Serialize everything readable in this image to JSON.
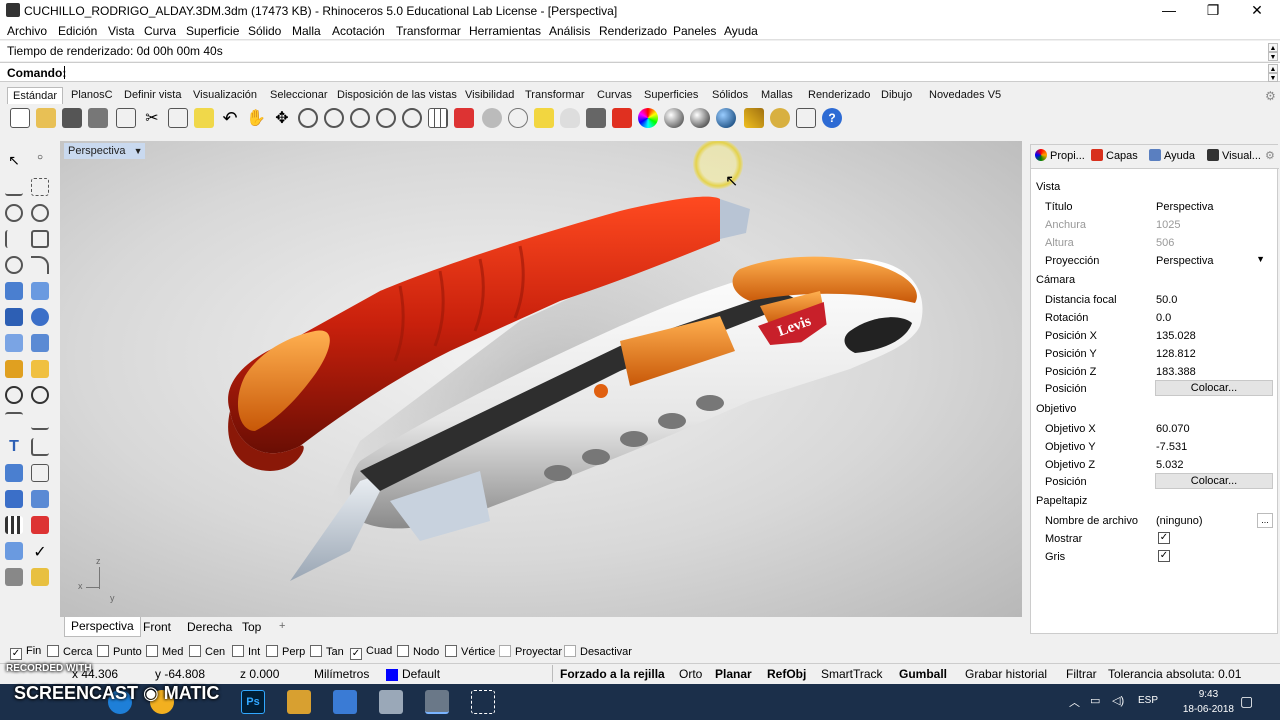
{
  "window": {
    "title": "CUCHILLO_RODRIGO_ALDAY.3DM.3dm (17473 KB) - Rhinoceros 5.0 Educational Lab License - [Perspectiva]",
    "minimize": "—",
    "maximize": "❐",
    "close": "✕"
  },
  "menu": [
    "Archivo",
    "Edición",
    "Vista",
    "Curva",
    "Superficie",
    "Sólido",
    "Malla",
    "Acotación",
    "Transformar",
    "Herramientas",
    "Análisis",
    "Renderizado",
    "Paneles",
    "Ayuda"
  ],
  "history": "Tiempo de renderizado: 0d 00h 00m 40s",
  "command": {
    "label": "Comando:",
    "value": ""
  },
  "toolbar_tabs": [
    "Estándar",
    "PlanosC",
    "Definir vista",
    "Visualización",
    "Seleccionar",
    "Disposición de las vistas",
    "Visibilidad",
    "Transformar",
    "Curvas",
    "Superficies",
    "Sólidos",
    "Mallas",
    "Renderizado",
    "Dibujo",
    "Novedades V5"
  ],
  "viewport": {
    "title": "Perspectiva",
    "axes_z": "z",
    "axes_x": "x",
    "axes_y": "y",
    "logo_text": "Levis"
  },
  "viewport_tabs": [
    "Perspectiva",
    "Front",
    "Derecha",
    "Top",
    "+"
  ],
  "panel": {
    "tabs": [
      "Propi...",
      "Capas",
      "Ayuda",
      "Visual..."
    ],
    "sections": {
      "vista": "Vista",
      "camara": "Cámara",
      "objetivo": "Objetivo",
      "papeltapiz": "Papeltapiz"
    },
    "rows": {
      "titulo": {
        "k": "Título",
        "v": "Perspectiva"
      },
      "anchura": {
        "k": "Anchura",
        "v": "1025"
      },
      "altura": {
        "k": "Altura",
        "v": "506"
      },
      "proyeccion": {
        "k": "Proyección",
        "v": "Perspectiva"
      },
      "focal": {
        "k": "Distancia focal",
        "v": "50.0"
      },
      "rotacion": {
        "k": "Rotación",
        "v": "0.0"
      },
      "posx": {
        "k": "Posición X",
        "v": "135.028"
      },
      "posy": {
        "k": "Posición Y",
        "v": "128.812"
      },
      "posz": {
        "k": "Posición Z",
        "v": "183.388"
      },
      "pos": {
        "k": "Posición",
        "v": "Colocar..."
      },
      "objx": {
        "k": "Objetivo X",
        "v": "60.070"
      },
      "objy": {
        "k": "Objetivo Y",
        "v": "-7.531"
      },
      "objz": {
        "k": "Objetivo Z",
        "v": "5.032"
      },
      "pos2": {
        "k": "Posición",
        "v": "Colocar..."
      },
      "archivo": {
        "k": "Nombre de archivo",
        "v": "(ninguno)",
        "btn": "..."
      },
      "mostrar": {
        "k": "Mostrar",
        "v": "✓"
      },
      "gris": {
        "k": "Gris",
        "v": "✓"
      }
    }
  },
  "osnaps": [
    {
      "label": "Fin",
      "checked": true
    },
    {
      "label": "Cerca",
      "checked": false
    },
    {
      "label": "Punto",
      "checked": false
    },
    {
      "label": "Med",
      "checked": false
    },
    {
      "label": "Cen",
      "checked": false
    },
    {
      "label": "Int",
      "checked": false
    },
    {
      "label": "Perp",
      "checked": false
    },
    {
      "label": "Tan",
      "checked": false
    },
    {
      "label": "Cuad",
      "checked": true
    },
    {
      "label": "Nodo",
      "checked": false
    },
    {
      "label": "Vértice",
      "checked": false
    },
    {
      "label": "Proyectar",
      "checked": false
    },
    {
      "label": "Desactivar",
      "checked": false
    }
  ],
  "status": {
    "x": "x 44.306",
    "y": "y -64.808",
    "z": "z 0.000",
    "units": "Milímetros",
    "layer": "Default",
    "grid": "Forzado a la rejilla",
    "orto": "Orto",
    "planar": "Planar",
    "refobj": "RefObj",
    "smarttrack": "SmartTrack",
    "gumball": "Gumball",
    "history": "Grabar historial",
    "filter": "Filtrar",
    "tolerance": "Tolerancia absoluta: 0.01"
  },
  "taskbar": {
    "lang": "ESP",
    "time": "9:43",
    "date": "18-06-2018"
  },
  "watermark": {
    "top": "RECORDED WITH",
    "brand": "SCREENCAST ◉ MATIC"
  },
  "colors": {
    "viewport_title": "#c9d9ef",
    "layer": "#0000ff",
    "knife_red": "#c8200c",
    "knife_orange": "#e87a10"
  }
}
